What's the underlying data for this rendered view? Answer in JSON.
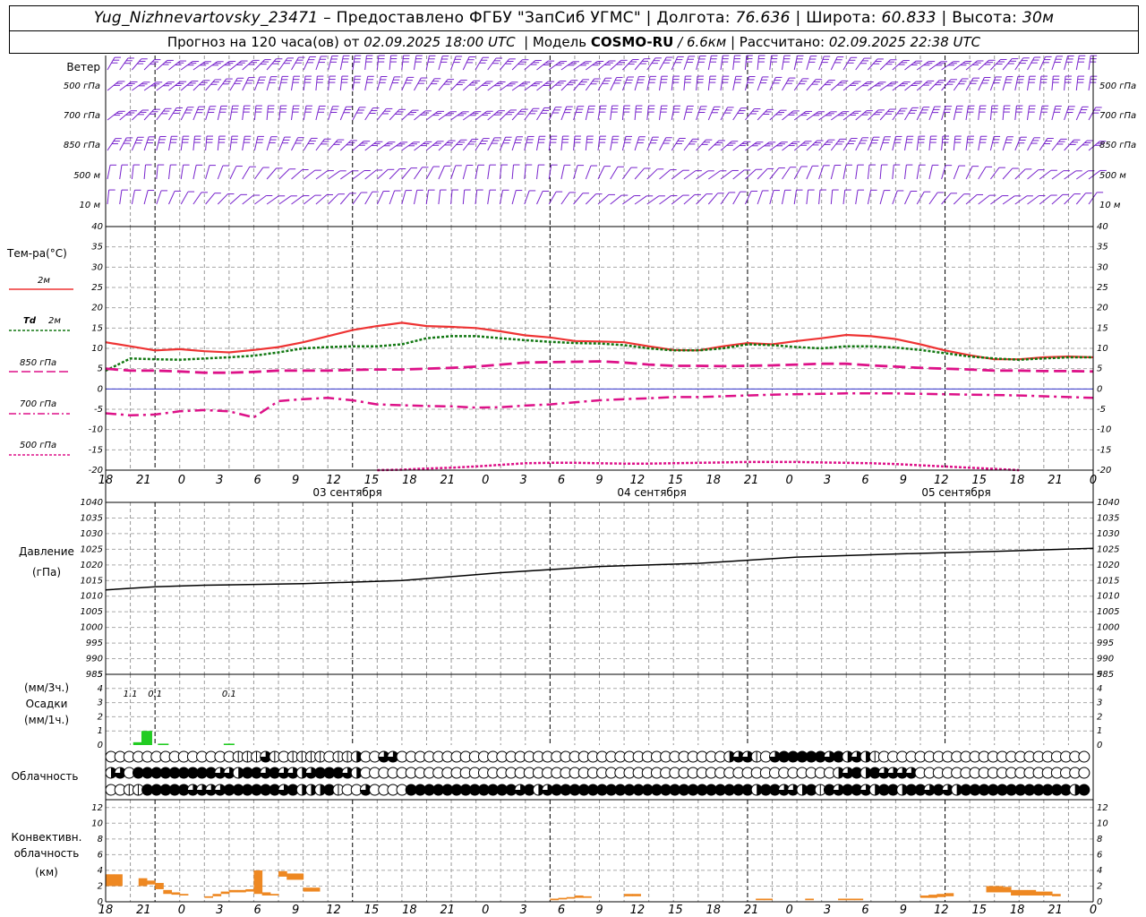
{
  "header": {
    "station": "Yug_Nizhnevartovsky_23471",
    "dash": "–",
    "provided_by": "Предоставлено ФГБУ \"ЗапСиб УГМС\"",
    "lon_label": "Долгота:",
    "lon_value": "76.636",
    "lat_label": "Широта:",
    "lat_value": "60.833",
    "alt_label": "Высота:",
    "alt_value": "30м",
    "forecast_text": "Прогноз на 120 часа(ов) от",
    "forecast_time": "02.09.2025 18:00 UTC",
    "model_label": "Модель",
    "model_name": "COSMO-RU",
    "model_res": "/ 6.6км",
    "calc_label": "Рассчитано:",
    "calc_time": "02.09.2025 22:38 UTC"
  },
  "labels": {
    "wind": "Ветер",
    "wind_levels": [
      "500 гПа",
      "700 гПа",
      "850 гПа",
      "500 м",
      "10  м"
    ],
    "temp_title": "Тем-ра(°C)",
    "t2m": "2м",
    "td_sym": "Td",
    "td_2m": "2м",
    "t850": "850 гПа",
    "t700": "700 гПа",
    "t500": "500 гПа",
    "pressure_1": "Давление",
    "pressure_2": "(гПа)",
    "precip_1": "(мм/3ч.)",
    "precip_2": "Осадки",
    "precip_3": "(мм/1ч.)",
    "cloud": "Облачность",
    "conv_1": "Конвективн.",
    "conv_2": "облачность",
    "conv_3": "(км)"
  },
  "colors": {
    "t2m": "#ee3333",
    "td2m": "#117711",
    "t850": "#dd1188",
    "t700": "#dd1188",
    "t500": "#dd1188",
    "wind": "#7722cc",
    "zero_line": "#3333cc",
    "precip": "#22cc22",
    "conv": "#ee8822",
    "pressure": "#000000"
  },
  "x_axis": {
    "hour_labels": [
      "18",
      "21",
      "0",
      "3",
      "6",
      "9",
      "12",
      "15",
      "18",
      "21",
      "0",
      "3",
      "6",
      "9",
      "12",
      "15",
      "18",
      "21",
      "0",
      "3",
      "6",
      "9",
      "12",
      "15",
      "18",
      "21",
      "0"
    ],
    "days": [
      "03 сентября",
      "04 сентября",
      "05 сентября"
    ]
  },
  "chart_data": [
    {
      "type": "line",
      "panel": "temperature",
      "ylim": [
        -20,
        40
      ],
      "yticks": [
        40,
        35,
        30,
        25,
        20,
        15,
        10,
        5,
        0,
        -5,
        -10,
        -15,
        -20
      ],
      "x_hours": [
        0,
        3,
        6,
        9,
        12,
        15,
        18,
        21,
        24,
        27,
        30,
        33,
        36,
        39,
        42,
        45,
        48,
        51,
        54,
        57,
        60,
        63,
        66,
        69,
        72,
        75,
        78,
        81,
        84,
        87,
        90,
        93,
        96,
        99,
        102,
        105,
        108,
        111,
        114,
        117,
        120
      ],
      "series": [
        {
          "name": "2м",
          "values": [
            11.5,
            10.5,
            9.5,
            9.8,
            9.3,
            9.0,
            9.6,
            10.3,
            11.5,
            13,
            14.5,
            15.5,
            16.3,
            15.5,
            15.3,
            15,
            14.2,
            13.2,
            12.7,
            11.8,
            11.7,
            11.5,
            10.5,
            9.6,
            9.5,
            10.5,
            11.3,
            11,
            11.8,
            12.5,
            13.3,
            13,
            12.3,
            11,
            9.5,
            8.3,
            7.3,
            7.3,
            7.8,
            8,
            7.8
          ]
        },
        {
          "name": "Td 2м",
          "values": [
            4.5,
            7.5,
            7.3,
            7.2,
            7.5,
            7.8,
            8.2,
            9.0,
            10,
            10.3,
            10.5,
            10.5,
            11,
            12.5,
            13,
            13,
            12.5,
            12,
            11.6,
            11.3,
            11.2,
            10.8,
            10,
            9.5,
            9.5,
            10,
            11,
            10.8,
            10.3,
            10.0,
            10.5,
            10.5,
            10.2,
            9.6,
            8.8,
            8,
            7.5,
            7.2,
            7.5,
            7.8,
            7.8
          ]
        },
        {
          "name": "850 гПа",
          "values": [
            5,
            4.5,
            4.5,
            4.3,
            4,
            4,
            4.2,
            4.5,
            4.5,
            4.5,
            4.7,
            4.8,
            4.8,
            5,
            5.2,
            5.5,
            6,
            6.5,
            6.6,
            6.7,
            6.8,
            6.5,
            6,
            5.7,
            5.7,
            5.6,
            5.7,
            5.8,
            6,
            6.2,
            6.2,
            5.8,
            5.5,
            5.2,
            5,
            4.8,
            4.5,
            4.5,
            4.4,
            4.4,
            4.3
          ]
        },
        {
          "name": "700 гПа",
          "values": [
            -6,
            -6.5,
            -6.3,
            -5.5,
            -5.2,
            -5.5,
            -7,
            -3,
            -2.5,
            -2.2,
            -2.8,
            -3.8,
            -4,
            -4.2,
            -4.3,
            -4.6,
            -4.5,
            -4.1,
            -3.8,
            -3.3,
            -2.8,
            -2.5,
            -2.3,
            -2,
            -2,
            -1.8,
            -1.6,
            -1.4,
            -1.3,
            -1.2,
            -1.1,
            -1.1,
            -1.1,
            -1.2,
            -1.3,
            -1.4,
            -1.5,
            -1.6,
            -1.8,
            -2,
            -2.2
          ]
        },
        {
          "name": "500 гПа",
          "values": [
            null,
            null,
            null,
            null,
            null,
            null,
            null,
            null,
            null,
            null,
            null,
            -20,
            -19.9,
            -19.6,
            -19.4,
            -19.1,
            -18.7,
            -18.3,
            -18.2,
            -18.2,
            -18.3,
            -18.4,
            -18.4,
            -18.3,
            -18.2,
            -18.1,
            -18.0,
            -18.0,
            -18.0,
            -18.1,
            -18.2,
            -18.3,
            -18.5,
            -18.8,
            -19.1,
            -19.4,
            -19.7,
            -20,
            null,
            null,
            null
          ]
        }
      ]
    },
    {
      "type": "line",
      "panel": "pressure",
      "ylim": [
        985,
        1040
      ],
      "yticks": [
        1040,
        1035,
        1030,
        1025,
        1020,
        1015,
        1010,
        1005,
        1000,
        995,
        990,
        985
      ],
      "x_hours": [
        0,
        6,
        12,
        24,
        36,
        48,
        60,
        72,
        84,
        96,
        108,
        120
      ],
      "series": [
        {
          "name": "Давление",
          "values": [
            1012,
            1013,
            1013.5,
            1014,
            1015,
            1017.5,
            1019.5,
            1020.5,
            1022.5,
            1023.5,
            1024.3,
            1025.3
          ]
        }
      ]
    },
    {
      "type": "bar",
      "panel": "precipitation",
      "ylim": [
        0,
        5
      ],
      "yticks": [
        5,
        4,
        3,
        2,
        1,
        0
      ],
      "labels_3h": [
        {
          "hour": 3,
          "text": "1.1"
        },
        {
          "hour": 6,
          "text": "0.1"
        },
        {
          "hour": 15,
          "text": "0.1"
        }
      ],
      "bars_1h": [
        {
          "hour": 4,
          "value": 0.2
        },
        {
          "hour": 5,
          "value": 1.0
        },
        {
          "hour": 7,
          "value": 0.1
        },
        {
          "hour": 15,
          "value": 0.1
        }
      ]
    },
    {
      "type": "bar",
      "panel": "convective_cloud",
      "ylim": [
        0,
        13
      ],
      "yticks": [
        12,
        10,
        8,
        6,
        4,
        2,
        0
      ],
      "bars": [
        {
          "hour": 0.5,
          "base": 2.0,
          "top": 3.5
        },
        {
          "hour": 1.5,
          "base": 2.0,
          "top": 3.5
        },
        {
          "hour": 4.5,
          "base": 2.0,
          "top": 3.0
        },
        {
          "hour": 5.5,
          "base": 2.2,
          "top": 2.7
        },
        {
          "hour": 6.5,
          "base": 1.6,
          "top": 2.4
        },
        {
          "hour": 7.5,
          "base": 1.0,
          "top": 1.5
        },
        {
          "hour": 8.5,
          "base": 0.9,
          "top": 1.2
        },
        {
          "hour": 9.5,
          "base": 0.8,
          "top": 1.0
        },
        {
          "hour": 12.5,
          "base": 0.5,
          "top": 0.7
        },
        {
          "hour": 13.5,
          "base": 0.7,
          "top": 1.0
        },
        {
          "hour": 14.5,
          "base": 1.0,
          "top": 1.3
        },
        {
          "hour": 15.5,
          "base": 1.2,
          "top": 1.5
        },
        {
          "hour": 16.5,
          "base": 1.2,
          "top": 1.5
        },
        {
          "hour": 17.5,
          "base": 1.3,
          "top": 1.6
        },
        {
          "hour": 18.5,
          "base": 1.0,
          "top": 4.0
        },
        {
          "hour": 19.5,
          "base": 0.8,
          "top": 1.2
        },
        {
          "hour": 20.5,
          "base": 0.8,
          "top": 1.0
        },
        {
          "hour": 21.5,
          "base": 3.2,
          "top": 3.9
        },
        {
          "hour": 22.5,
          "base": 2.8,
          "top": 3.6
        },
        {
          "hour": 23.5,
          "base": 2.8,
          "top": 3.6
        },
        {
          "hour": 24.5,
          "base": 1.3,
          "top": 1.8
        },
        {
          "hour": 25.5,
          "base": 1.3,
          "top": 1.8
        },
        {
          "hour": 54.5,
          "base": 0.2,
          "top": 0.4
        },
        {
          "hour": 55.5,
          "base": 0.3,
          "top": 0.5
        },
        {
          "hour": 56.5,
          "base": 0.4,
          "top": 0.6
        },
        {
          "hour": 57.5,
          "base": 0.5,
          "top": 0.8
        },
        {
          "hour": 58.5,
          "base": 0.5,
          "top": 0.7
        },
        {
          "hour": 63.5,
          "base": 0.7,
          "top": 1.0
        },
        {
          "hour": 64.5,
          "base": 0.7,
          "top": 1.0
        },
        {
          "hour": 79.5,
          "base": 0.2,
          "top": 0.4
        },
        {
          "hour": 80.5,
          "base": 0.2,
          "top": 0.4
        },
        {
          "hour": 85.5,
          "base": 0.2,
          "top": 0.4
        },
        {
          "hour": 89.5,
          "base": 0.2,
          "top": 0.4
        },
        {
          "hour": 90.5,
          "base": 0.2,
          "top": 0.4
        },
        {
          "hour": 91.5,
          "base": 0.2,
          "top": 0.4
        },
        {
          "hour": 99.5,
          "base": 0.5,
          "top": 0.8
        },
        {
          "hour": 100.5,
          "base": 0.5,
          "top": 0.9
        },
        {
          "hour": 101.5,
          "base": 0.6,
          "top": 1.0
        },
        {
          "hour": 102.5,
          "base": 0.7,
          "top": 1.1
        },
        {
          "hour": 107.5,
          "base": 1.2,
          "top": 2.0
        },
        {
          "hour": 108.5,
          "base": 1.2,
          "top": 2.0
        },
        {
          "hour": 109.5,
          "base": 1.2,
          "top": 1.9
        },
        {
          "hour": 110.5,
          "base": 0.8,
          "top": 1.5
        },
        {
          "hour": 111.5,
          "base": 0.8,
          "top": 1.5
        },
        {
          "hour": 112.5,
          "base": 0.8,
          "top": 1.5
        },
        {
          "hour": 113.5,
          "base": 0.8,
          "top": 1.3
        },
        {
          "hour": 114.5,
          "base": 0.8,
          "top": 1.3
        },
        {
          "hour": 115.5,
          "base": 0.7,
          "top": 1.0
        }
      ]
    },
    {
      "type": "table",
      "panel": "cloud_cover",
      "rows": [
        "000000000000001113101111011200330000000000000000000000000000000000002331034444434232100000000000000000000000",
        "230444444444332443433234443200000000000000000000000000000000000000000000000000002342433330000000000000000000",
        "001144444333344444434222410030000444444444444342344444444444444444444442443324143443244244343244444444444424"
      ]
    }
  ]
}
